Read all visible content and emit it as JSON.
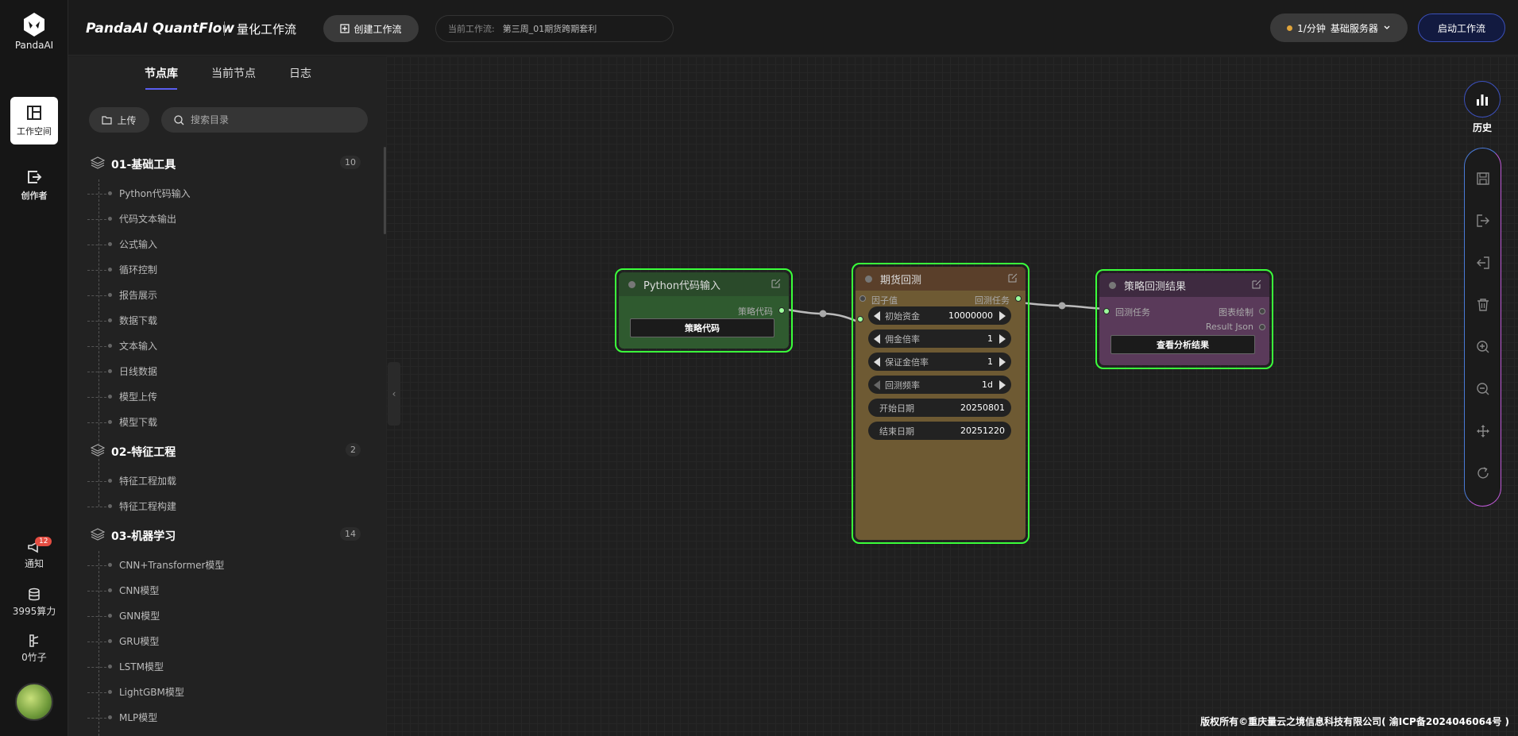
{
  "app": {
    "logo_text": "PandaAI",
    "brand": "PandaAI QuantFlow",
    "brand_sub": "量化工作流"
  },
  "header": {
    "create_label": "创建工作流",
    "current_label": "当前工作流:",
    "current_value": "第三周_01期货跨期套利",
    "server_rate": "1/分钟",
    "server_name": "基础服务器",
    "start_label": "启动工作流"
  },
  "rail": {
    "workspace": "工作空间",
    "creator": "创作者",
    "notify": "通知",
    "notify_count": "12",
    "compute": "3995算力",
    "bamboo": "0竹子"
  },
  "panel": {
    "tabs": [
      "节点库",
      "当前节点",
      "日志"
    ],
    "upload": "上传",
    "search_placeholder": "搜索目录",
    "categories": [
      {
        "name": "01-基础工具",
        "count": "10",
        "items": [
          "Python代码输入",
          "代码文本输出",
          "公式输入",
          "循环控制",
          "报告展示",
          "数据下载",
          "文本输入",
          "日线数据",
          "模型上传",
          "模型下载"
        ]
      },
      {
        "name": "02-特征工程",
        "count": "2",
        "items": [
          "特征工程加载",
          "特征工程构建"
        ]
      },
      {
        "name": "03-机器学习",
        "count": "14",
        "items": [
          "CNN+Transformer模型",
          "CNN模型",
          "GNN模型",
          "GRU模型",
          "LSTM模型",
          "LightGBM模型",
          "MLP模型"
        ]
      }
    ]
  },
  "nodes": {
    "python": {
      "title": "Python代码输入",
      "out_label": "策略代码",
      "button": "策略代码",
      "bg": "#2f5a2f"
    },
    "futures": {
      "title": "期货回测",
      "in_label": "因子值",
      "out_label": "回测任务",
      "bg": "#6e5a33",
      "title_bg": "#5a3f2a",
      "widgets": [
        {
          "label": "初始资金",
          "value": "10000000",
          "arrows": true
        },
        {
          "label": "佣金倍率",
          "value": "1",
          "arrows": true
        },
        {
          "label": "保证金倍率",
          "value": "1",
          "arrows": true
        },
        {
          "label": "回测频率",
          "value": "1d",
          "arrows": true
        },
        {
          "label": "开始日期",
          "value": "20250801",
          "arrows": false
        },
        {
          "label": "结束日期",
          "value": "20251220",
          "arrows": false
        }
      ]
    },
    "result": {
      "title": "策略回测结果",
      "in_label": "回测任务",
      "out_label_1": "图表绘制",
      "out_label_2": "Result Json",
      "button": "查看分析结果",
      "bg": "#5a3a5a",
      "title_bg": "#3e2a40"
    }
  },
  "toolbar": {
    "history": "历史",
    "tools": [
      "save-icon",
      "export-icon",
      "import-icon",
      "delete-icon",
      "zoom-in-icon",
      "zoom-out-icon",
      "move-icon",
      "refresh-icon"
    ]
  },
  "footer": {
    "copyright": "版权所有©重庆量云之境信息科技有限公司( 渝ICP备2024046064号 )"
  }
}
